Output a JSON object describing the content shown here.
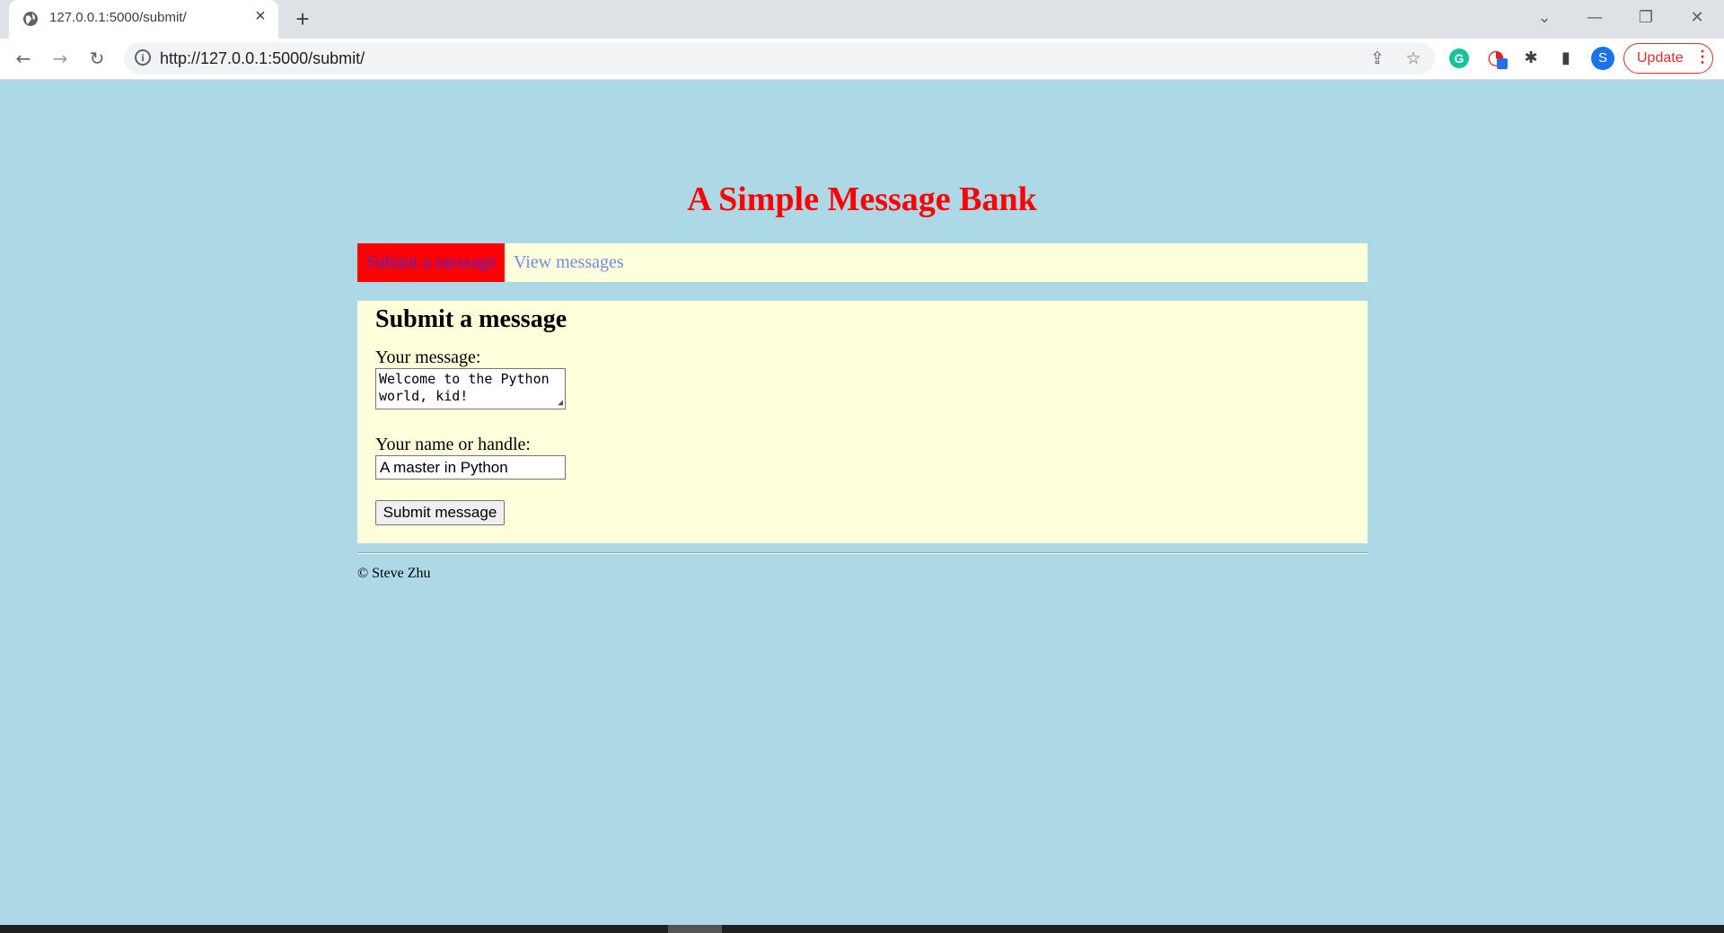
{
  "browser": {
    "tab_title": "127.0.0.1:5000/submit/",
    "url": "http://127.0.0.1:5000/submit/",
    "update_label": "Update",
    "profile_initial": "S"
  },
  "page": {
    "title": "A Simple Message Bank",
    "nav": {
      "active_label": "Submit a message",
      "link_label": "View messages"
    },
    "form": {
      "heading": "Submit a message",
      "message_label": "Your message:",
      "message_value": "Welcome to the Python world, kid!",
      "name_label": "Your name or handle:",
      "name_value": "A master in Python",
      "submit_label": "Submit message"
    },
    "footer": "© Steve Zhu"
  },
  "colors": {
    "page_bg": "#add8e6",
    "panel_bg": "#ffffdc",
    "title": "#ff0000",
    "nav_active_bg": "#ff0000",
    "link": "#6b8ee8"
  }
}
